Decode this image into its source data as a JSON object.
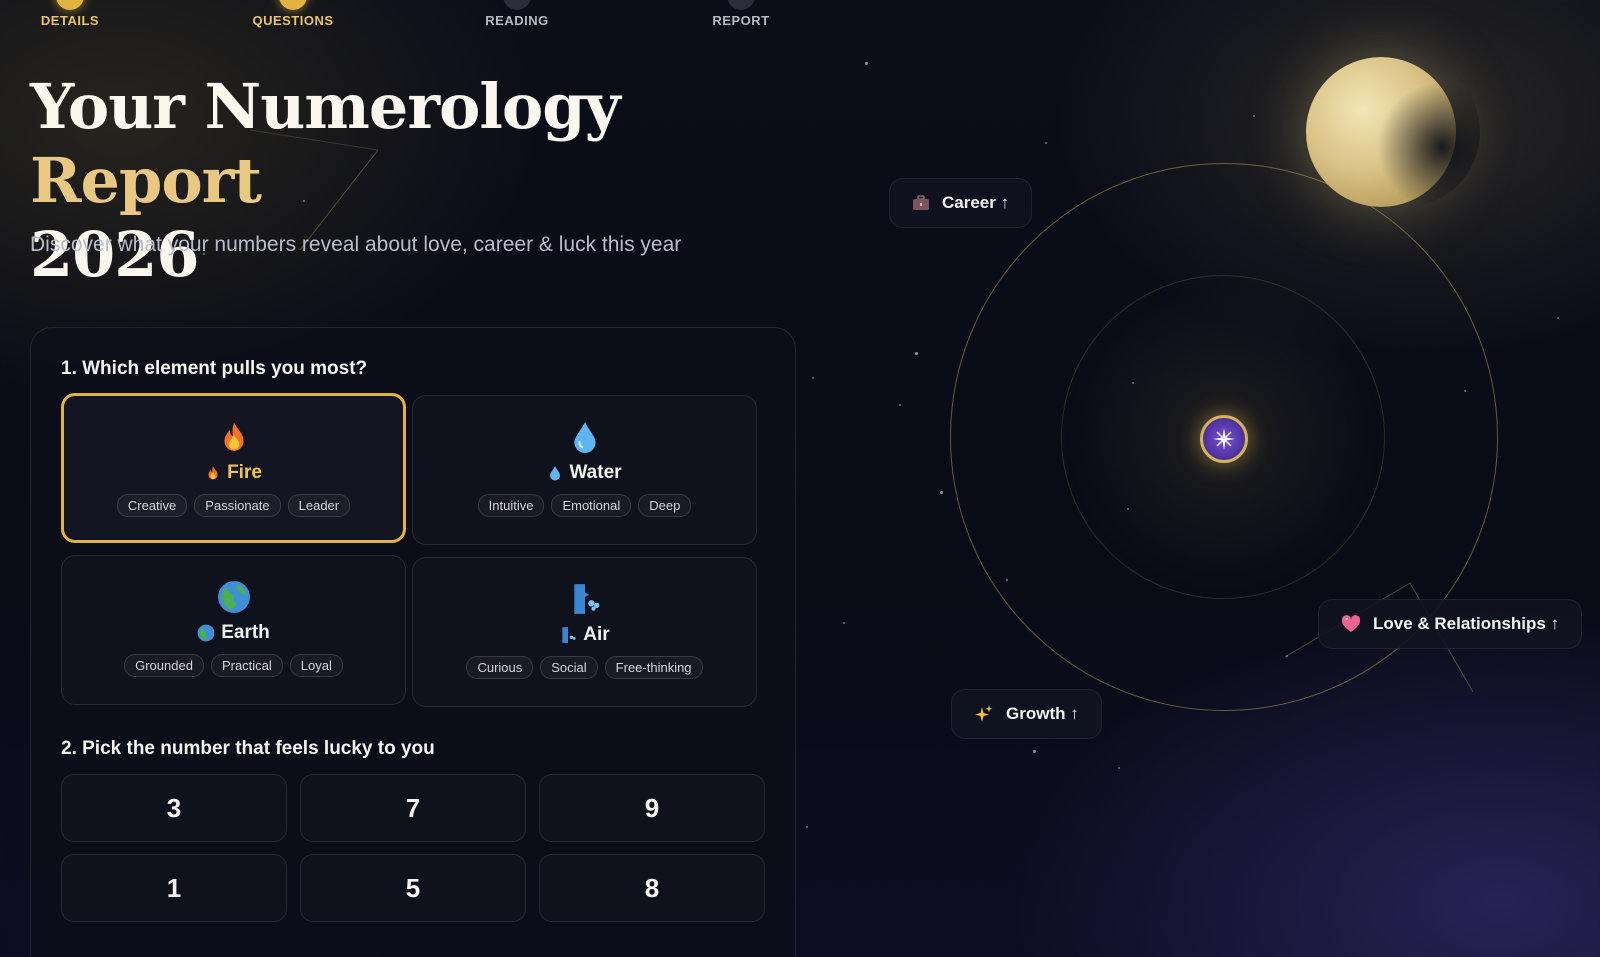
{
  "steps": [
    {
      "label": "DETAILS",
      "state": "done"
    },
    {
      "label": "QUESTIONS",
      "state": "active"
    },
    {
      "label": "READING",
      "state": "upcoming"
    },
    {
      "label": "REPORT",
      "state": "upcoming"
    }
  ],
  "hero": {
    "title_main": "Your Numerology ",
    "title_accent": "Report",
    "title_year": "2026",
    "subtitle": "Discover what your numbers reveal about love, career & luck this year"
  },
  "quiz": {
    "q1": {
      "title": "1. Which element pulls you most?",
      "selected": "Fire",
      "options": [
        {
          "name": "Fire",
          "icon": "fire-icon",
          "tags": [
            "Creative",
            "Passionate",
            "Leader"
          ]
        },
        {
          "name": "Water",
          "icon": "water-drop-icon",
          "tags": [
            "Intuitive",
            "Emotional",
            "Deep"
          ]
        },
        {
          "name": "Earth",
          "icon": "globe-icon",
          "tags": [
            "Grounded",
            "Practical",
            "Loyal"
          ]
        },
        {
          "name": "Air",
          "icon": "wind-face-icon",
          "tags": [
            "Curious",
            "Social",
            "Free-thinking"
          ]
        }
      ]
    },
    "q2": {
      "title": "2. Pick the number that feels lucky to you",
      "numbers": [
        "3",
        "7",
        "9",
        "1",
        "5",
        "8"
      ]
    }
  },
  "orbit_chips": {
    "career": {
      "label": "Career ↑",
      "icon": "briefcase-icon"
    },
    "love": {
      "label": "Love & Relationships ↑",
      "icon": "heart-icon"
    },
    "growth": {
      "label": "Growth ↑",
      "icon": "sparkles-icon"
    }
  },
  "colors": {
    "gold": "#e3b341",
    "background": "#0b0d18",
    "accent_text": "#e9c884"
  }
}
